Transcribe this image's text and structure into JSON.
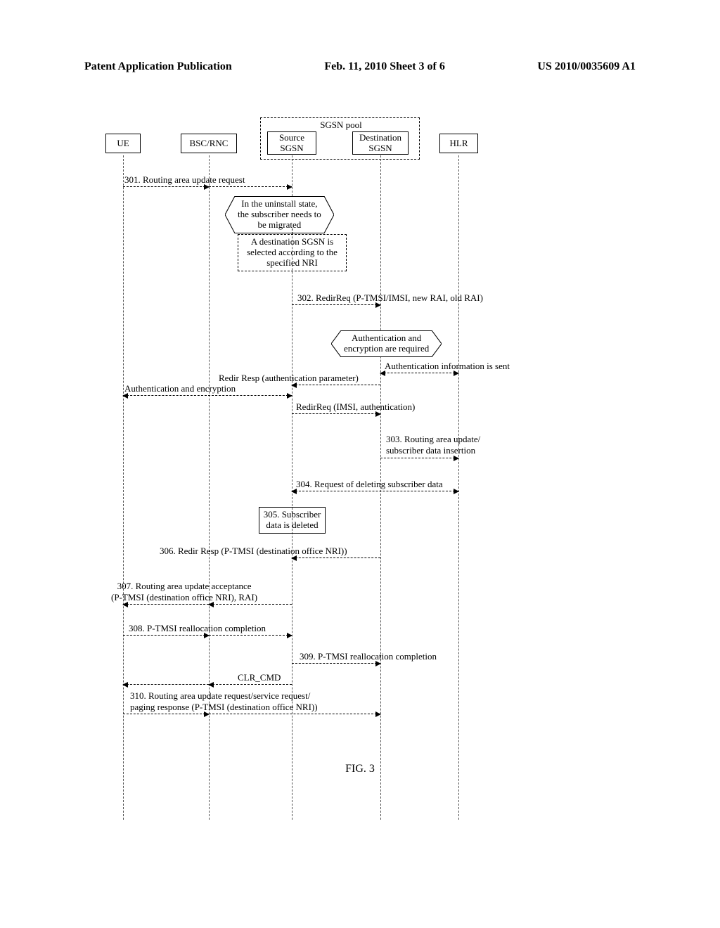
{
  "header": {
    "pub_type": "Patent Application Publication",
    "date_sheet": "Feb. 11, 2010   Sheet 3 of 6",
    "pub_number": "US 2010/0035609 A1"
  },
  "entities": {
    "ue": "UE",
    "bsc_rnc": "BSC/RNC",
    "pool_label": "SGSN pool",
    "source_sgsn": "Source\nSGSN",
    "dest_sgsn": "Destination\nSGSN",
    "hlr": "HLR"
  },
  "notes": {
    "uninstall": "In the uninstall state,\nthe subscriber needs to\nbe migrated",
    "select_dest": "A destination SGSN is\nselected according to the\nspecified NRI",
    "auth_required": "Authentication and\nencryption are required",
    "sub_deleted_title": "305. Subscriber\ndata is deleted"
  },
  "messages": {
    "m301": "301. Routing area update request",
    "m302": "302. RedirReq (P-TMSI/IMSI, new RAI, old RAI)",
    "auth_info_sent": "Authentication information is sent",
    "redir_resp_auth": "Redir Resp (authentication parameter)",
    "auth_enc": "Authentication and encryption",
    "redir_req_imsi": "RedirReq (IMSI, authentication)",
    "m303": "303. Routing area update/\nsubscriber data insertion",
    "m304": "304. Request of deleting subscriber data",
    "m306": "306. Redir Resp (P-TMSI (destination office NRI))",
    "m307": "307. Routing area update acceptance\n(P-TMSI (destination office NRI), RAI)",
    "m308": "308. P-TMSI reallocation completion",
    "m309": "309. P-TMSI reallocation completion",
    "clr_cmd": "CLR_CMD",
    "m310": "310. Routing area update request/service request/\npaging response (P-TMSI (destination office NRI))"
  },
  "figure_label": "FIG. 3"
}
